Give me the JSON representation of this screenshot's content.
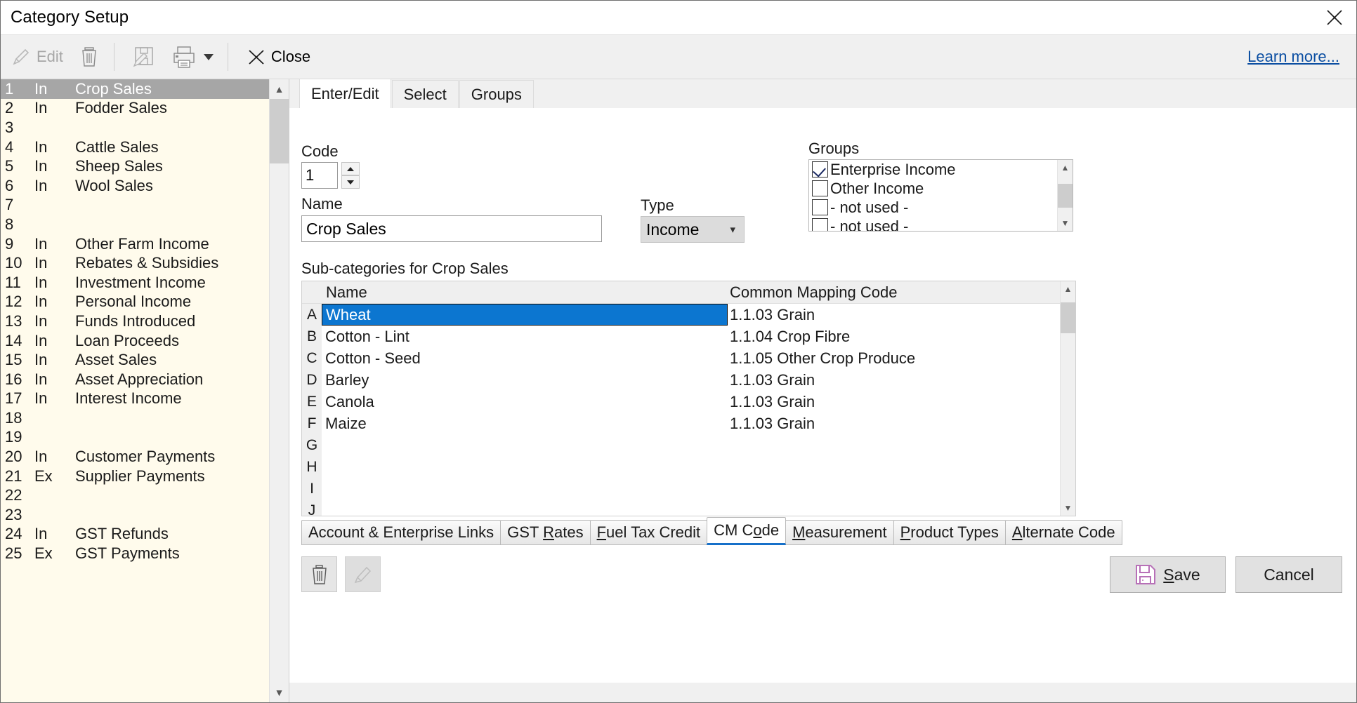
{
  "window": {
    "title": "Category Setup",
    "close_icon": "close-icon"
  },
  "toolbar": {
    "edit_label": "Edit",
    "edit_icon": "pencil-icon",
    "delete_icon": "trash-icon",
    "save_edit_icon": "save-edit-icon",
    "print_icon": "printer-icon",
    "print_dropdown_icon": "chevron-down-icon",
    "close_label": "Close",
    "close_icon": "x-icon",
    "learn_more_label": "Learn more..."
  },
  "categories": [
    {
      "num": "1",
      "type": "In",
      "name": "Crop Sales",
      "selected": true
    },
    {
      "num": "2",
      "type": "In",
      "name": "Fodder Sales",
      "selected": false
    },
    {
      "num": "3",
      "type": "",
      "name": "",
      "selected": false
    },
    {
      "num": "4",
      "type": "In",
      "name": "Cattle Sales",
      "selected": false
    },
    {
      "num": "5",
      "type": "In",
      "name": "Sheep Sales",
      "selected": false
    },
    {
      "num": "6",
      "type": "In",
      "name": "Wool Sales",
      "selected": false
    },
    {
      "num": "7",
      "type": "",
      "name": "",
      "selected": false
    },
    {
      "num": "8",
      "type": "",
      "name": "",
      "selected": false
    },
    {
      "num": "9",
      "type": "In",
      "name": "Other Farm Income",
      "selected": false
    },
    {
      "num": "10",
      "type": "In",
      "name": "Rebates & Subsidies",
      "selected": false
    },
    {
      "num": "11",
      "type": "In",
      "name": "Investment Income",
      "selected": false
    },
    {
      "num": "12",
      "type": "In",
      "name": "Personal Income",
      "selected": false
    },
    {
      "num": "13",
      "type": "In",
      "name": "Funds Introduced",
      "selected": false
    },
    {
      "num": "14",
      "type": "In",
      "name": "Loan Proceeds",
      "selected": false
    },
    {
      "num": "15",
      "type": "In",
      "name": "Asset Sales",
      "selected": false
    },
    {
      "num": "16",
      "type": "In",
      "name": "Asset Appreciation",
      "selected": false
    },
    {
      "num": "17",
      "type": "In",
      "name": "Interest Income",
      "selected": false
    },
    {
      "num": "18",
      "type": "",
      "name": "",
      "selected": false
    },
    {
      "num": "19",
      "type": "",
      "name": "",
      "selected": false
    },
    {
      "num": "20",
      "type": "In",
      "name": "Customer Payments",
      "selected": false
    },
    {
      "num": "21",
      "type": "Ex",
      "name": "Supplier Payments",
      "selected": false
    },
    {
      "num": "22",
      "type": "",
      "name": "",
      "selected": false
    },
    {
      "num": "23",
      "type": "",
      "name": "",
      "selected": false
    },
    {
      "num": "24",
      "type": "In",
      "name": "GST Refunds",
      "selected": false
    },
    {
      "num": "25",
      "type": "Ex",
      "name": "GST Payments",
      "selected": false
    }
  ],
  "tabs": [
    {
      "label": "Enter/Edit",
      "active": true
    },
    {
      "label": "Select",
      "active": false
    },
    {
      "label": "Groups",
      "active": false
    }
  ],
  "form": {
    "code_label": "Code",
    "code_value": "1",
    "name_label": "Name",
    "name_value": "Crop Sales",
    "type_label": "Type",
    "type_value": "Income",
    "type_chevron_icon": "chevron-down-icon",
    "groups_label": "Groups",
    "groups": [
      {
        "label": "Enterprise Income",
        "checked": true
      },
      {
        "label": "Other Income",
        "checked": false
      },
      {
        "label": "- not used -",
        "checked": false
      },
      {
        "label": "- not used -",
        "checked": false
      }
    ],
    "subcat_label": "Sub-categories for Crop Sales",
    "grid_headers": {
      "letter": "",
      "name": "Name",
      "cmc": "Common Mapping Code"
    },
    "subcategories": [
      {
        "letter": "A",
        "name": "Wheat",
        "cmc": "1.1.03 Grain",
        "selected": true
      },
      {
        "letter": "B",
        "name": "Cotton - Lint",
        "cmc": "1.1.04 Crop Fibre",
        "selected": false
      },
      {
        "letter": "C",
        "name": "Cotton - Seed",
        "cmc": "1.1.05 Other Crop Produce",
        "selected": false
      },
      {
        "letter": "D",
        "name": "Barley",
        "cmc": "1.1.03 Grain",
        "selected": false
      },
      {
        "letter": "E",
        "name": "Canola",
        "cmc": "1.1.03 Grain",
        "selected": false
      },
      {
        "letter": "F",
        "name": "Maize",
        "cmc": "1.1.03 Grain",
        "selected": false
      },
      {
        "letter": "G",
        "name": "",
        "cmc": "",
        "selected": false
      },
      {
        "letter": "H",
        "name": "",
        "cmc": "",
        "selected": false
      },
      {
        "letter": "I",
        "name": "",
        "cmc": "",
        "selected": false
      },
      {
        "letter": "J",
        "name": "",
        "cmc": "",
        "selected": false
      }
    ]
  },
  "bottom_tabs": [
    {
      "label": "Account & Enterprise Links",
      "accel": "",
      "active": false
    },
    {
      "label": "GST Rates",
      "accel": "R",
      "active": false
    },
    {
      "label": "Fuel Tax Credit",
      "accel": "F",
      "active": false
    },
    {
      "label": "CM Code",
      "accel": "o",
      "active": true
    },
    {
      "label": "Measurement",
      "accel": "M",
      "active": false
    },
    {
      "label": "Product Types",
      "accel": "P",
      "active": false
    },
    {
      "label": "Alternate Code",
      "accel": "A",
      "active": false
    }
  ],
  "actions": {
    "delete_icon": "trash-icon",
    "edit_icon": "pencil-icon",
    "save_label": "Save",
    "save_accel": "S",
    "save_icon": "floppy-disk-icon",
    "cancel_label": "Cancel"
  },
  "colors": {
    "list_background": "#fffbec",
    "row_selected": "#a6a6a6",
    "grid_row_selected": "#0c76d0",
    "accent_tab": "#1670c9",
    "link": "#0b4ea2",
    "save_icon": "#b770b7",
    "checkmark": "#1b2a63"
  }
}
